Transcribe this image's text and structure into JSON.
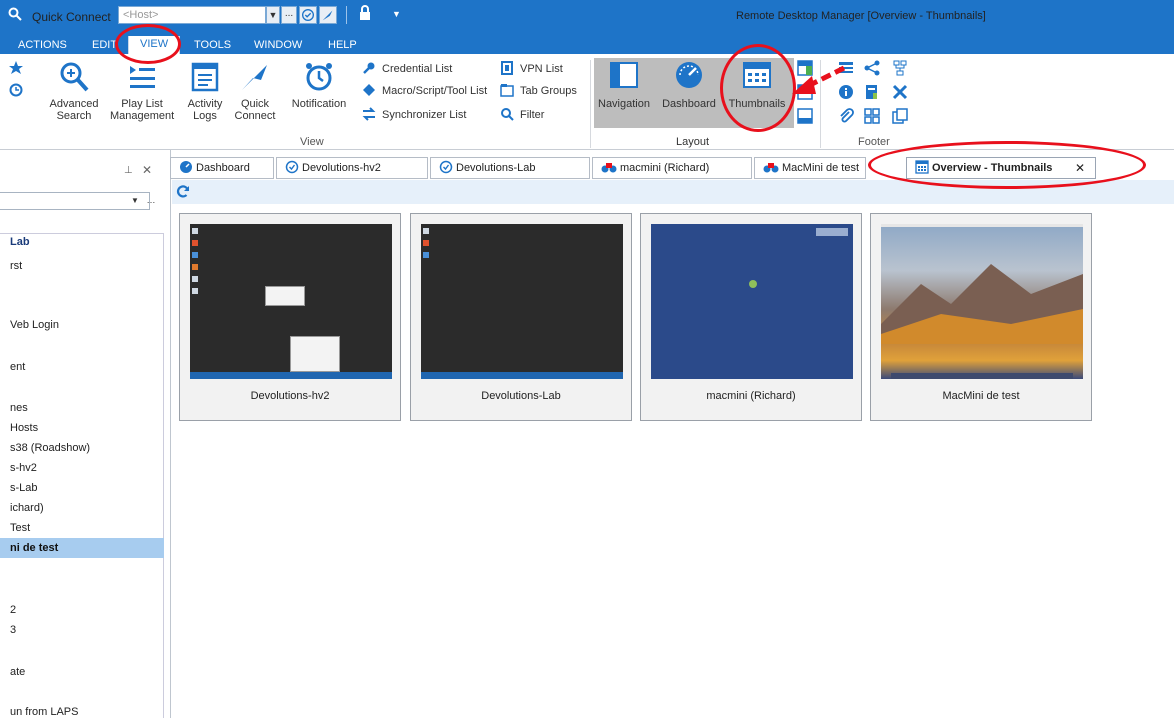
{
  "titlebar": {
    "quick_connect_label": "Quick Connect",
    "host_placeholder": "<Host>",
    "app_title": "Remote Desktop Manager [Overview - Thumbnails]",
    "more": "..."
  },
  "menus": [
    "ACTIONS",
    "EDIT",
    "VIEW",
    "TOOLS",
    "WINDOW",
    "HELP"
  ],
  "ribbon": {
    "advanced_search": [
      "Advanced",
      "Search"
    ],
    "play_list": [
      "Play List",
      "Management"
    ],
    "activity_logs": [
      "Activity",
      "Logs"
    ],
    "quick_connect": [
      "Quick",
      "Connect"
    ],
    "notification": "Notification",
    "credential_list": "Credential List",
    "macro_list": "Macro/Script/Tool List",
    "synchronizer_list": "Synchronizer List",
    "vpn_list": "VPN List",
    "tab_groups": "Tab Groups",
    "filter": "Filter",
    "navigation": "Navigation",
    "dashboard": "Dashboard",
    "thumbnails": "Thumbnails",
    "group_view": "View",
    "group_layout": "Layout",
    "group_footer": "Footer"
  },
  "left_pane": {
    "pin": "⊥",
    "close": "✕",
    "items": [
      "Lab",
      "rst",
      "Veb Login",
      "ent",
      "nes",
      "Hosts",
      "s38 (Roadshow)",
      "s-hv2",
      "s-Lab",
      "ichard)",
      "Test",
      "ni de test",
      "2",
      "3",
      "ate",
      "un from LAPS"
    ]
  },
  "tabs": [
    {
      "label": "Dashboard"
    },
    {
      "label": "Devolutions-hv2"
    },
    {
      "label": "Devolutions-Lab"
    },
    {
      "label": "macmini (Richard)"
    },
    {
      "label": "MacMini de test"
    },
    {
      "label": "Overview - Thumbnails"
    }
  ],
  "tab_close": "✕",
  "thumbnails": [
    {
      "label": "Devolutions-hv2"
    },
    {
      "label": "Devolutions-Lab"
    },
    {
      "label": "macmini (Richard)"
    },
    {
      "label": "MacMini de test"
    }
  ],
  "colors": {
    "accent": "#1e74c8",
    "annotation": "#e8101c",
    "selection": "#a7ccef"
  }
}
